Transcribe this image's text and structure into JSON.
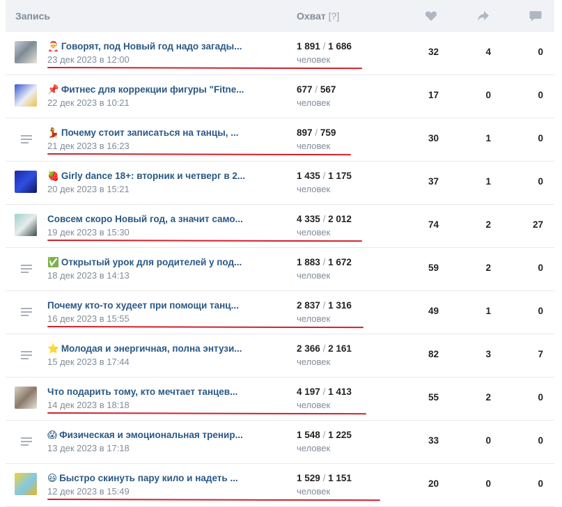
{
  "header": {
    "post_label": "Запись",
    "reach_label": "Охват",
    "reach_help": "[?]"
  },
  "colors": {
    "link": "#2a5885",
    "muted": "#818c99",
    "underline": "#d1212b",
    "header_bg": "#f0f2f5"
  },
  "rows": [
    {
      "title": "Говорят, под Новый год надо загады...",
      "emoji": "🎅",
      "date": "23 дек 2023 в 12:00",
      "reach": "1 891",
      "reach2": "1 686",
      "unit": "человек",
      "likes": "32",
      "shares": "4",
      "comments": "0",
      "thumb": "photo",
      "underlined": true
    },
    {
      "title": "Фитнес для коррекции фигуры \"Fitne...",
      "emoji": "📌",
      "date": "22 дек 2023 в 10:21",
      "reach": "677",
      "reach2": "567",
      "unit": "человек",
      "likes": "17",
      "shares": "0",
      "comments": "0",
      "thumb": "photo",
      "underlined": false
    },
    {
      "title": "Почему стоит записаться на танцы, ...",
      "emoji": "💃",
      "date": "21 дек 2023 в 16:23",
      "reach": "897",
      "reach2": "759",
      "unit": "человек",
      "likes": "30",
      "shares": "1",
      "comments": "0",
      "thumb": "text",
      "underlined": true
    },
    {
      "title": "Girly dance 18+: вторник и четверг в 2...",
      "emoji": "🍓",
      "date": "20 дек 2023 в 15:21",
      "reach": "1 435",
      "reach2": "1 175",
      "unit": "человек",
      "likes": "37",
      "shares": "1",
      "comments": "0",
      "thumb": "photo",
      "underlined": false
    },
    {
      "title": "Совсем скоро Новый год, а значит само...",
      "emoji": "",
      "date": "19 дек 2023 в 15:30",
      "reach": "4 335",
      "reach2": "2 012",
      "unit": "человек",
      "likes": "74",
      "shares": "2",
      "comments": "27",
      "thumb": "photo",
      "underlined": true
    },
    {
      "title": "Открытый урок для родителей у под...",
      "emoji": "✅",
      "date": "18 дек 2023 в 14:13",
      "reach": "1 883",
      "reach2": "1 672",
      "unit": "человек",
      "likes": "59",
      "shares": "2",
      "comments": "0",
      "thumb": "text",
      "underlined": false
    },
    {
      "title": "Почему кто-то худеет при помощи танц...",
      "emoji": "",
      "date": "16 дек 2023 в 15:55",
      "reach": "2 837",
      "reach2": "1 316",
      "unit": "человек",
      "likes": "49",
      "shares": "1",
      "comments": "0",
      "thumb": "text",
      "underlined": true
    },
    {
      "title": "Молодая и энергичная, полна энтузи...",
      "emoji": "⭐",
      "date": "15 дек 2023 в 17:44",
      "reach": "2 366",
      "reach2": "2 161",
      "unit": "человек",
      "likes": "82",
      "shares": "3",
      "comments": "7",
      "thumb": "text",
      "underlined": false
    },
    {
      "title": "Что подарить тому, кто мечтает танцев...",
      "emoji": "",
      "date": "14 дек 2023 в 18:18",
      "reach": "4 197",
      "reach2": "1 413",
      "unit": "человек",
      "likes": "55",
      "shares": "2",
      "comments": "0",
      "thumb": "photo",
      "underlined": true
    },
    {
      "title": "Физическая и эмоциональная тренир...",
      "emoji": "😱",
      "date": "13 дек 2023 в 17:18",
      "reach": "1 548",
      "reach2": "1 225",
      "unit": "человек",
      "likes": "33",
      "shares": "0",
      "comments": "0",
      "thumb": "text",
      "underlined": false
    },
    {
      "title": "Быстро скинуть пару кило и надеть ...",
      "emoji": "😃",
      "date": "12 дек 2023 в 15:49",
      "reach": "1 529",
      "reach2": "1 151",
      "unit": "человек",
      "likes": "20",
      "shares": "0",
      "comments": "0",
      "thumb": "photo",
      "underlined": true
    }
  ]
}
